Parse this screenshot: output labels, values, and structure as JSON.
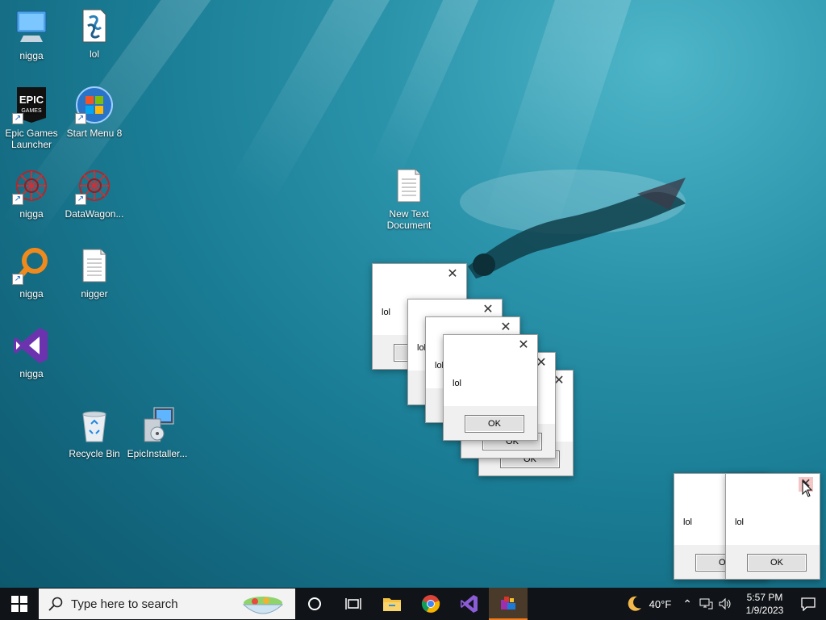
{
  "desktop": {
    "icons": [
      {
        "label": "nigga",
        "icon": "computer-icon"
      },
      {
        "label": "lol",
        "icon": "script-file-icon"
      },
      {
        "label": "Epic Games Launcher",
        "icon": "epic-games-icon"
      },
      {
        "label": "Start Menu 8",
        "icon": "windows-orb-icon"
      },
      {
        "label": "nigga",
        "icon": "red-network-icon"
      },
      {
        "label": "DataWagon...",
        "icon": "red-network-icon"
      },
      {
        "label": "nigga",
        "icon": "orange-magnifier-icon"
      },
      {
        "label": "nigger",
        "icon": "text-file-icon"
      },
      {
        "label": "nigga",
        "icon": "visual-studio-icon"
      },
      {
        "label": "Recycle Bin",
        "icon": "recycle-bin-icon"
      },
      {
        "label": "EpicInstaller...",
        "icon": "installer-icon"
      },
      {
        "label": "New Text Document",
        "icon": "text-file-icon"
      }
    ]
  },
  "dialogs": [
    {
      "message": "lol",
      "button": "OK"
    },
    {
      "message": "lol",
      "button": "OK"
    },
    {
      "message": "lol",
      "button": "OK"
    },
    {
      "message": "lol",
      "button": "OK"
    },
    {
      "message": "lol",
      "button": "OK"
    },
    {
      "message": "lol",
      "button": "OK"
    },
    {
      "message": "lol",
      "button": "OK"
    },
    {
      "message": "lol",
      "button": "OK"
    }
  ],
  "taskbar": {
    "search_placeholder": "Type here to search",
    "apps": [
      "cortana-icon",
      "task-view-icon",
      "file-explorer-icon",
      "chrome-icon",
      "visual-studio-icon",
      "winrar-icon"
    ],
    "weather": "40°F",
    "time": "5:57 PM",
    "date": "1/9/2023"
  },
  "colors": {
    "taskbar": "#101317",
    "active_app": "#f07c1b",
    "accent": "#0078d4"
  }
}
